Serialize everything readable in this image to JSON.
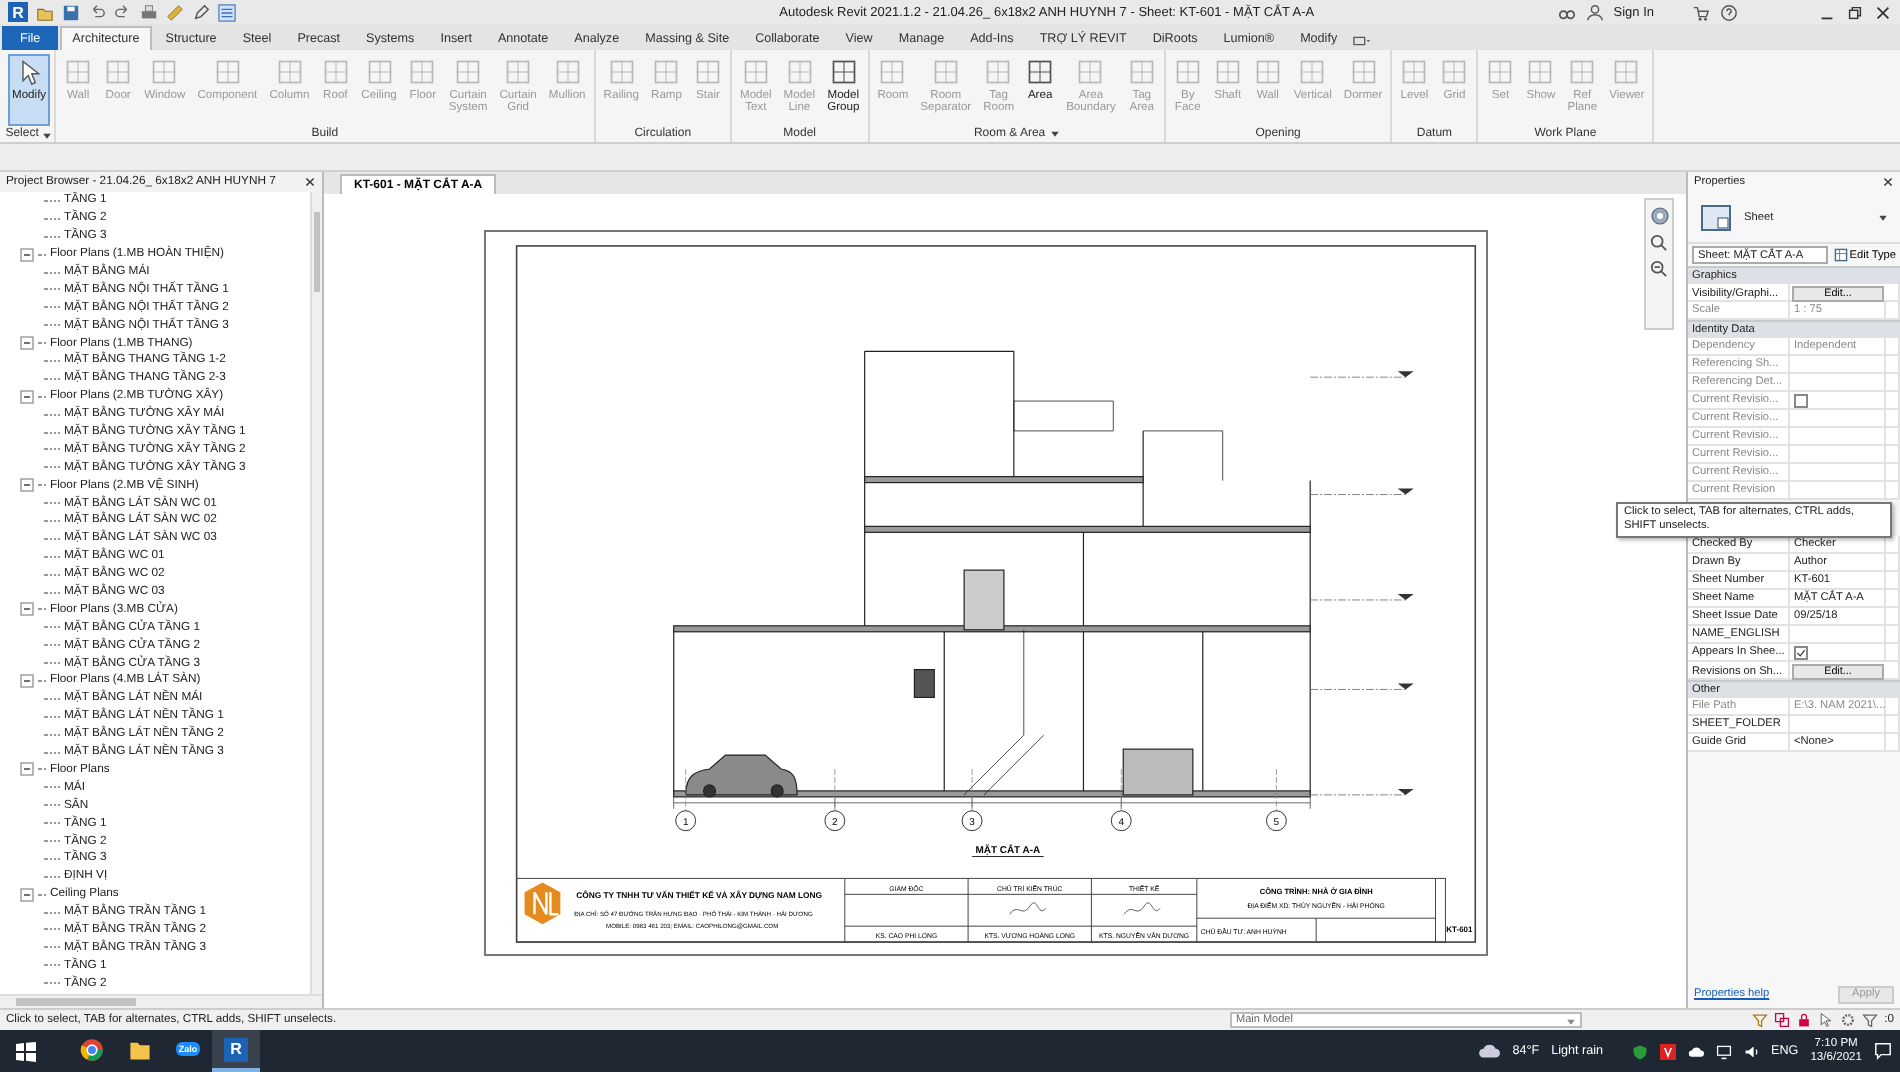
{
  "titlebar": {
    "logo": "R",
    "title": "Autodesk Revit 2021.1.2 - 21.04.26_ 6x18x2 ANH HUYNH 7 - Sheet: KT-601 - MẶT CẮT A-A",
    "sign_in": "Sign In"
  },
  "file_menu": "File",
  "tabs": [
    {
      "label": "Architecture",
      "kind": "tab",
      "selected": true
    },
    {
      "label": "Structure",
      "kind": "tab",
      "selected": false
    },
    {
      "label": "Steel",
      "kind": "tab",
      "selected": false
    },
    {
      "label": "Precast",
      "kind": "tab",
      "selected": false
    },
    {
      "label": "Systems",
      "kind": "tab",
      "selected": false
    },
    {
      "label": "Insert",
      "kind": "tab",
      "selected": false
    },
    {
      "label": "Annotate",
      "kind": "tab",
      "selected": false
    },
    {
      "label": "Analyze",
      "kind": "tab",
      "selected": false
    },
    {
      "label": "Massing & Site",
      "kind": "tab",
      "selected": false
    },
    {
      "label": "Collaborate",
      "kind": "tab",
      "selected": false
    },
    {
      "label": "View",
      "kind": "tab",
      "selected": false
    },
    {
      "label": "Manage",
      "kind": "tab",
      "selected": false
    },
    {
      "label": "Add-Ins",
      "kind": "tab",
      "selected": false
    },
    {
      "label": "TRỢ LÝ REVIT",
      "kind": "tab",
      "selected": false
    },
    {
      "label": "DiRoots",
      "kind": "tab",
      "selected": false
    },
    {
      "label": "Lumion®",
      "kind": "tab",
      "selected": false
    },
    {
      "label": "Modify",
      "kind": "tab",
      "selected": false
    }
  ],
  "ribbon": {
    "panels": [
      {
        "label": "Select",
        "menu": true,
        "buttons": [
          {
            "label": "Modify",
            "disabled": false,
            "selected": true
          }
        ]
      },
      {
        "label": "Build",
        "menu": false,
        "buttons": [
          {
            "label": "Wall",
            "disabled": true,
            "selected": false
          },
          {
            "label": "Door",
            "disabled": true,
            "selected": false
          },
          {
            "label": "Window",
            "disabled": true,
            "selected": false
          },
          {
            "label": "Component",
            "disabled": true,
            "selected": false
          },
          {
            "label": "Column",
            "disabled": true,
            "selected": false
          },
          {
            "label": "Roof",
            "disabled": true,
            "selected": false
          },
          {
            "label": "Ceiling",
            "disabled": true,
            "selected": false
          },
          {
            "label": "Floor",
            "disabled": true,
            "selected": false
          },
          {
            "label": "Curtain System",
            "disabled": true,
            "selected": false
          },
          {
            "label": "Curtain Grid",
            "disabled": true,
            "selected": false
          },
          {
            "label": "Mullion",
            "disabled": true,
            "selected": false
          }
        ]
      },
      {
        "label": "Circulation",
        "menu": false,
        "buttons": [
          {
            "label": "Railing",
            "disabled": true,
            "selected": false
          },
          {
            "label": "Ramp",
            "disabled": true,
            "selected": false
          },
          {
            "label": "Stair",
            "disabled": true,
            "selected": false
          }
        ]
      },
      {
        "label": "Model",
        "menu": false,
        "buttons": [
          {
            "label": "Model Text",
            "disabled": true,
            "selected": false
          },
          {
            "label": "Model Line",
            "disabled": true,
            "selected": false
          },
          {
            "label": "Model Group",
            "disabled": false,
            "selected": false
          }
        ]
      },
      {
        "label": "Room & Area",
        "menu": true,
        "buttons": [
          {
            "label": "Room",
            "disabled": true,
            "selected": false
          },
          {
            "label": "Room Separator",
            "disabled": true,
            "selected": false
          },
          {
            "label": "Tag Room",
            "disabled": true,
            "selected": false
          },
          {
            "label": "Area",
            "disabled": false,
            "selected": false
          },
          {
            "label": "Area Boundary",
            "disabled": true,
            "selected": false
          },
          {
            "label": "Tag Area",
            "disabled": true,
            "selected": false
          }
        ]
      },
      {
        "label": "Opening",
        "menu": false,
        "buttons": [
          {
            "label": "By Face",
            "disabled": true,
            "selected": false
          },
          {
            "label": "Shaft",
            "disabled": true,
            "selected": false
          },
          {
            "label": "Wall",
            "disabled": true,
            "selected": false
          },
          {
            "label": "Vertical",
            "disabled": true,
            "selected": false
          },
          {
            "label": "Dormer",
            "disabled": true,
            "selected": false
          }
        ]
      },
      {
        "label": "Datum",
        "menu": false,
        "buttons": [
          {
            "label": "Level",
            "disabled": true,
            "selected": false
          },
          {
            "label": "Grid",
            "disabled": true,
            "selected": false
          }
        ]
      },
      {
        "label": "Work Plane",
        "menu": false,
        "buttons": [
          {
            "label": "Set",
            "disabled": true,
            "selected": false
          },
          {
            "label": "Show",
            "disabled": true,
            "selected": false
          },
          {
            "label": "Ref Plane",
            "disabled": true,
            "selected": false
          },
          {
            "label": "Viewer",
            "disabled": true,
            "selected": false
          }
        ]
      }
    ]
  },
  "project_browser": {
    "title": "Project Browser - 21.04.26_ 6x18x2 ANH HUYNH 7",
    "tree": [
      {
        "label": "TẦNG 1"
      },
      {
        "label": "TẦNG 2"
      },
      {
        "label": "TẦNG 3"
      },
      {
        "label": "Floor Plans (1.MB HOÀN THIỆN)",
        "expanded": true,
        "children": [
          {
            "label": "MẶT BẰNG MÁI"
          },
          {
            "label": "MẶT BẰNG NỘI THẤT TẦNG 1"
          },
          {
            "label": "MẶT BẰNG NỘI THẤT TẦNG 2"
          },
          {
            "label": "MẶT BẰNG NỘI THẤT TẦNG 3"
          }
        ]
      },
      {
        "label": "Floor Plans (1.MB THANG)",
        "expanded": true,
        "children": [
          {
            "label": "MẶT BẰNG THANG TẦNG 1-2"
          },
          {
            "label": "MẶT BẰNG THANG TẦNG 2-3"
          }
        ]
      },
      {
        "label": "Floor Plans (2.MB TƯỜNG XÂY)",
        "expanded": true,
        "children": [
          {
            "label": "MẶT BẰNG TƯỜNG XÂY MÁI"
          },
          {
            "label": "MẶT BẰNG TƯỜNG XÂY TẦNG 1"
          },
          {
            "label": "MẶT BẰNG TƯỜNG XÂY TẦNG 2"
          },
          {
            "label": "MẶT BẰNG TƯỜNG XÂY TẦNG 3"
          }
        ]
      },
      {
        "label": "Floor Plans (2.MB VỆ SINH)",
        "expanded": true,
        "children": [
          {
            "label": "MẶT BẰNG LÁT SÀN WC 01"
          },
          {
            "label": "MẶT BẰNG LÁT SÀN WC 02"
          },
          {
            "label": "MẶT BẰNG LÁT SÀN WC 03"
          },
          {
            "label": "MẶT BẰNG WC 01"
          },
          {
            "label": "MẶT BẰNG WC 02"
          },
          {
            "label": "MẶT BẰNG WC 03"
          }
        ]
      },
      {
        "label": "Floor Plans (3.MB CỬA)",
        "expanded": true,
        "children": [
          {
            "label": "MẶT BẰNG CỬA TẦNG 1"
          },
          {
            "label": "MẶT BẰNG CỬA TẦNG 2"
          },
          {
            "label": "MẶT BẰNG CỬA TẦNG 3"
          }
        ]
      },
      {
        "label": "Floor Plans (4.MB LÁT SÀN)",
        "expanded": true,
        "children": [
          {
            "label": "MẶT BẰNG LÁT NỀN MÁI"
          },
          {
            "label": "MẶT BẰNG LÁT NỀN TẦNG 1"
          },
          {
            "label": "MẶT BẰNG LÁT NỀN TẦNG 2"
          },
          {
            "label": "MẶT BẰNG LÁT NỀN TẦNG 3"
          }
        ]
      },
      {
        "label": "Floor Plans",
        "expanded": true,
        "children": [
          {
            "label": "MÁI"
          },
          {
            "label": "SÂN"
          },
          {
            "label": "TẦNG 1"
          },
          {
            "label": "TẦNG 2"
          },
          {
            "label": "TẦNG 3"
          },
          {
            "label": "ĐỊNH VỊ"
          }
        ]
      },
      {
        "label": "Ceiling Plans",
        "expanded": true,
        "children": [
          {
            "label": "MẶT BẰNG TRẦN TẦNG 1"
          },
          {
            "label": "MẶT BẰNG TRẦN TẦNG 2"
          },
          {
            "label": "MẶT BẰNG TRẦN TẦNG 3"
          },
          {
            "label": "TẦNG 1"
          },
          {
            "label": "TẦNG 2"
          }
        ]
      }
    ]
  },
  "view": {
    "tab": "KT-601 - MẶT CẮT A-A",
    "sheet": {
      "grid_labels": [
        "1",
        "2",
        "3",
        "4",
        "5"
      ],
      "view_title": "MẶT CẮT A-A",
      "title_block": {
        "company": "CÔNG TY TNHH TƯ VẤN THIẾT KẾ VÀ XÂY DỰNG NAM LONG",
        "address": "ĐỊA CHỈ: SỐ 47 ĐƯỜNG TRẦN HƯNG ĐẠO - PHỐ THÁI - KIM THÀNH - HẢI DƯƠNG",
        "contact": "MOBILE: 0983 461 203; EMAIL: CAOPHILONG@GMAIL.COM",
        "signatories": [
          {
            "role": "GIÁM ĐỐC",
            "name": "KS. CAO PHI LONG",
            "signed": false
          },
          {
            "role": "CHỦ TRÌ KIẾN TRÚC",
            "name": "KTS. VƯƠNG HOÀNG LONG",
            "signed": true
          },
          {
            "role": "THIẾT KẾ",
            "name": "KTS. NGUYỄN VĂN DƯƠNG",
            "signed": true
          }
        ],
        "project": "CÔNG TRÌNH: NHÀ Ở GIA ĐÌNH",
        "location": "ĐỊA ĐIỂM XD: THỦY NGUYÊN - HẢI PHÒNG",
        "owner": "CHỦ ĐẦU TƯ: ANH HUỲNH",
        "sheet_number": "KT-601"
      }
    }
  },
  "properties": {
    "title": "Properties",
    "type": "Sheet",
    "instance": "Sheet: MẶT CẮT A-A",
    "edit_type": "Edit Type",
    "sections": [
      {
        "title": "Graphics",
        "rows": [
          {
            "kind": "button",
            "label": "Visibility/Graphi...",
            "value": "Edit...",
            "disabled": false
          },
          {
            "kind": "text",
            "label": "Scale",
            "value": "1 : 75",
            "disabled": true
          }
        ]
      },
      {
        "title": "Identity Data",
        "rows": [
          {
            "kind": "text",
            "label": "Dependency",
            "value": "Independent",
            "disabled": true
          },
          {
            "kind": "empty",
            "label": "Referencing Sh...",
            "disabled": true
          },
          {
            "kind": "empty",
            "label": "Referencing Det...",
            "disabled": true
          },
          {
            "kind": "checkbox",
            "label": "Current Revisio...",
            "checked": false,
            "disabled": true
          },
          {
            "kind": "empty",
            "label": "Current Revisio...",
            "disabled": true
          },
          {
            "kind": "empty",
            "label": "Current Revisio...",
            "disabled": true
          },
          {
            "kind": "empty",
            "label": "Current Revisio...",
            "disabled": true
          },
          {
            "kind": "empty",
            "label": "Current Revisio...",
            "disabled": true
          },
          {
            "kind": "empty",
            "label": "Current Revision",
            "disabled": true
          },
          {
            "kind": "tooltip",
            "text": "Click to select, TAB for alternates, CTRL adds, SHIFT unselects."
          },
          {
            "kind": "text",
            "label": "Checked By",
            "value": "Checker",
            "disabled": false
          },
          {
            "kind": "text",
            "label": "Drawn By",
            "value": "Author",
            "disabled": false
          },
          {
            "kind": "text",
            "label": "Sheet Number",
            "value": "KT-601",
            "disabled": false
          },
          {
            "kind": "text",
            "label": "Sheet Name",
            "value": "MẶT CẮT A-A",
            "disabled": false
          },
          {
            "kind": "text",
            "label": "Sheet Issue Date",
            "value": "09/25/18",
            "disabled": false
          },
          {
            "kind": "empty",
            "label": "NAME_ENGLISH",
            "disabled": false
          },
          {
            "kind": "checkbox",
            "label": "Appears In Shee...",
            "checked": true,
            "disabled": false
          },
          {
            "kind": "button",
            "label": "Revisions on Sh...",
            "value": "Edit...",
            "disabled": false
          }
        ]
      },
      {
        "title": "Other",
        "rows": [
          {
            "kind": "text",
            "label": "File Path",
            "value": "E:\\3. NAM 2021\\...",
            "disabled": true
          },
          {
            "kind": "empty",
            "label": "SHEET_FOLDER",
            "disabled": false
          },
          {
            "kind": "text",
            "label": "Guide Grid",
            "value": "<None>",
            "disabled": false
          }
        ]
      }
    ],
    "help": "Properties help",
    "apply": "Apply"
  },
  "status_bar": {
    "message": "Click to select, TAB for alternates, CTRL adds, SHIFT unselects.",
    "model": "Main Model",
    "filter_count": ":0"
  },
  "taskbar": {
    "apps": [
      {
        "kind": "browser",
        "selected": false
      },
      {
        "kind": "folder",
        "selected": false
      },
      {
        "kind": "chat",
        "label": "Zalo",
        "selected": false
      },
      {
        "kind": "revit",
        "label": "R",
        "selected": true
      }
    ],
    "temperature": "84°F",
    "weather": "Light rain",
    "language": "ENG",
    "time": "7:10 PM",
    "date": "13/6/2021"
  }
}
